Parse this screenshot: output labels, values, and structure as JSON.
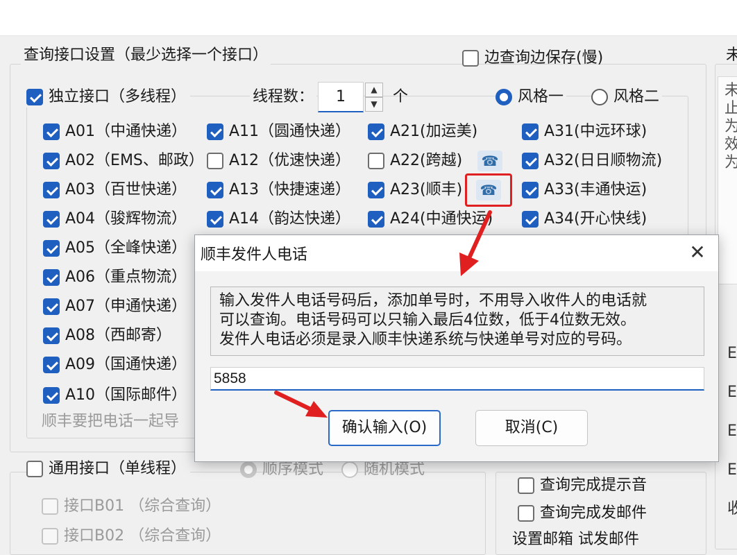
{
  "top": {
    "query_settings_title": "查询接口设置（最少选择一个接口）",
    "save_while_query": "边查询边保存(慢)",
    "right_edge_title": "未"
  },
  "standalone": {
    "label": "独立接口（多线程）",
    "threads_label": "线程数：",
    "threads_value": "1",
    "threads_unit": "个",
    "style1": "风格一",
    "style2": "风格二",
    "items": [
      [
        "A01（中通快递）",
        "A02（EMS、邮政）",
        "A03（百世快递）",
        "A04（骏辉物流）",
        "A05（全峰快递）",
        "A06（重点物流）",
        "A07（申通快递）",
        "A08（西邮寄）",
        "A09（国通快递）",
        "A10（国际邮件）"
      ],
      [
        "A11（圆通快递）",
        "A12（优速快递）",
        "A13（快捷速递）",
        "A14（韵达快递）"
      ],
      [
        "A21(加运美)",
        "A22(跨越)",
        "A23(顺丰)",
        "A24(中通快运)"
      ],
      [
        "A31(中远环球)",
        "A32(日日顺物流)",
        "A33(丰通快运)",
        "A34(开心快线)"
      ]
    ],
    "note": "顺丰要把电话一起导"
  },
  "general": {
    "label": "通用接口（单线程）",
    "mode_sequence": "顺序模式",
    "mode_random": "随机模式",
    "items": [
      "接口B01  （综合查询）",
      "接口B02  （综合查询）"
    ]
  },
  "options": {
    "sound": "查询完成提示音",
    "email": "查询完成发邮件",
    "partial": "设置邮箱    试发邮件"
  },
  "right_edge_chars": [
    "未",
    "止",
    "为",
    "效",
    "为",
    "E",
    "E",
    "E",
    "E",
    "收"
  ],
  "dialog": {
    "title": "顺丰发件人电话",
    "message": [
      "输入发件人电话号码后，添加单号时，不用导入收件人的电话就",
      "可以查询。电话号码可以只输入最后4位数，低于4位数无效。",
      "发件人电话必须是录入顺丰快递系统与快递单号对应的号码。"
    ],
    "input_value": "5858",
    "confirm": "确认输入(O)",
    "cancel": "取消(C)"
  },
  "colors": {
    "accent": "#1f5fbf",
    "annotation": "#e02020"
  }
}
